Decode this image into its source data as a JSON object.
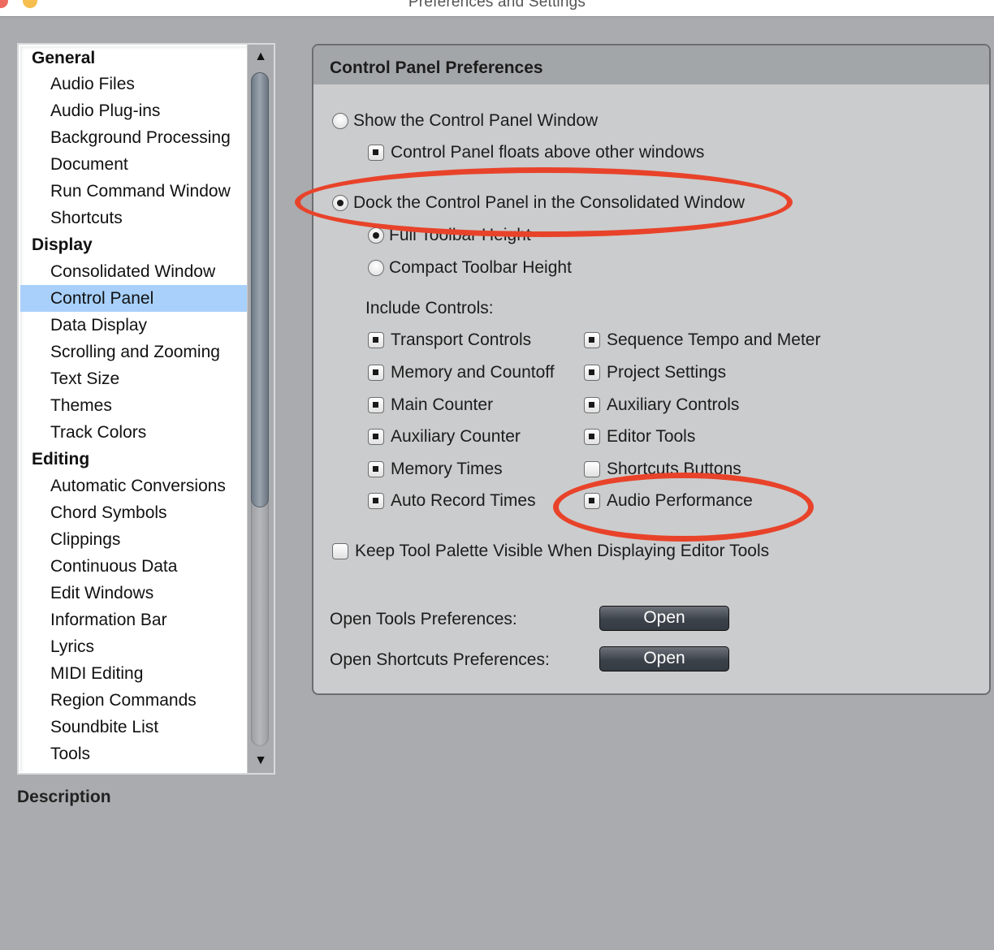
{
  "window": {
    "title": "Preferences and Settings"
  },
  "sidebar": {
    "items": [
      {
        "label": "General",
        "type": "header"
      },
      {
        "label": "Audio Files",
        "type": "item"
      },
      {
        "label": "Audio Plug-ins",
        "type": "item"
      },
      {
        "label": "Background Processing",
        "type": "item"
      },
      {
        "label": "Document",
        "type": "item"
      },
      {
        "label": "Run Command Window",
        "type": "item"
      },
      {
        "label": "Shortcuts",
        "type": "item"
      },
      {
        "label": "Display",
        "type": "header"
      },
      {
        "label": "Consolidated Window",
        "type": "item"
      },
      {
        "label": "Control Panel",
        "type": "item",
        "selected": true
      },
      {
        "label": "Data Display",
        "type": "item"
      },
      {
        "label": "Scrolling and Zooming",
        "type": "item"
      },
      {
        "label": "Text Size",
        "type": "item"
      },
      {
        "label": "Themes",
        "type": "item"
      },
      {
        "label": "Track Colors",
        "type": "item"
      },
      {
        "label": "Editing",
        "type": "header"
      },
      {
        "label": "Automatic Conversions",
        "type": "item"
      },
      {
        "label": "Chord Symbols",
        "type": "item"
      },
      {
        "label": "Clippings",
        "type": "item"
      },
      {
        "label": "Continuous Data",
        "type": "item"
      },
      {
        "label": "Edit Windows",
        "type": "item"
      },
      {
        "label": "Information Bar",
        "type": "item"
      },
      {
        "label": "Lyrics",
        "type": "item"
      },
      {
        "label": "MIDI Editing",
        "type": "item"
      },
      {
        "label": "Region Commands",
        "type": "item"
      },
      {
        "label": "Soundbite List",
        "type": "item"
      },
      {
        "label": "Tools",
        "type": "item"
      }
    ],
    "scroll_up_glyph": "▲",
    "scroll_down_glyph": "▼",
    "selection_color": "#a8d0fb"
  },
  "description": {
    "label": "Description"
  },
  "panel": {
    "title": "Control Panel Preferences",
    "show_window": {
      "label": "Show the Control Panel Window",
      "checked": false
    },
    "floats_above": {
      "label": "Control Panel floats above other windows",
      "checked": true
    },
    "dock": {
      "label": "Dock the Control Panel in the Consolidated Window",
      "checked": true
    },
    "full_toolbar": {
      "label": "Full Toolbar Height",
      "checked": true
    },
    "compact_toolbar": {
      "label": "Compact Toolbar Height",
      "checked": false
    },
    "include_controls_label": "Include Controls:",
    "controls_left": [
      {
        "label": "Transport Controls",
        "checked": true
      },
      {
        "label": "Memory and Countoff",
        "checked": true
      },
      {
        "label": "Main Counter",
        "checked": true
      },
      {
        "label": "Auxiliary Counter",
        "checked": true
      },
      {
        "label": "Memory Times",
        "checked": true
      },
      {
        "label": "Auto Record Times",
        "checked": true
      }
    ],
    "controls_right": [
      {
        "label": "Sequence Tempo and Meter",
        "checked": true
      },
      {
        "label": "Project Settings",
        "checked": true
      },
      {
        "label": "Auxiliary Controls",
        "checked": true
      },
      {
        "label": "Editor Tools",
        "checked": true
      },
      {
        "label": "Shortcuts Buttons",
        "checked": false
      },
      {
        "label": "Audio Performance",
        "checked": true
      }
    ],
    "keep_palette": {
      "label": "Keep Tool Palette Visible When Displaying Editor Tools",
      "checked": false
    },
    "open_tools": {
      "label": "Open Tools Preferences:",
      "button": "Open"
    },
    "open_shortcuts": {
      "label": "Open Shortcuts Preferences:",
      "button": "Open"
    }
  },
  "annotations": {
    "color": "#e8432a",
    "highlighted": [
      "Dock the Control Panel in the Consolidated Window",
      "Audio Performance"
    ]
  }
}
